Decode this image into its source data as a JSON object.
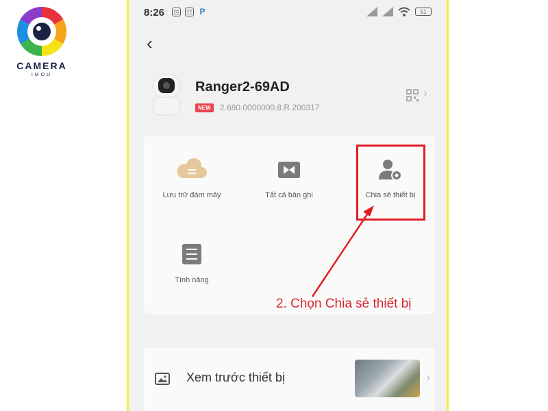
{
  "brand": {
    "name": "CAMERA",
    "sub": "IMOU"
  },
  "status_bar": {
    "time": "8:26",
    "icon_1": "⊡",
    "icon_2": "☷",
    "icon_3": "P",
    "battery": "51"
  },
  "device": {
    "name": "Ranger2-69AD",
    "badge": "NEW",
    "firmware": "2.680.0000000.8.R.200317"
  },
  "menu": {
    "items": [
      {
        "label": "Lưu trữ đám mây",
        "icon": "cloud-icon"
      },
      {
        "label": "Tất cả bản ghi",
        "icon": "video-record-icon"
      },
      {
        "label": "Chia sẻ thiết bị",
        "icon": "share-user-icon"
      },
      {
        "label": "Tính năng",
        "icon": "feature-list-icon"
      }
    ]
  },
  "annotation": "2. Chọn Chia sẻ thiết bị",
  "preview": {
    "label": "Xem trước thiết bị",
    "icon": "image-icon"
  },
  "colors": {
    "accent": "#e31b23",
    "badge": "#e8454d",
    "frame": "#f4ee3a",
    "icon_gold": "#e6c89c",
    "icon_gray": "#7b7b7b"
  }
}
